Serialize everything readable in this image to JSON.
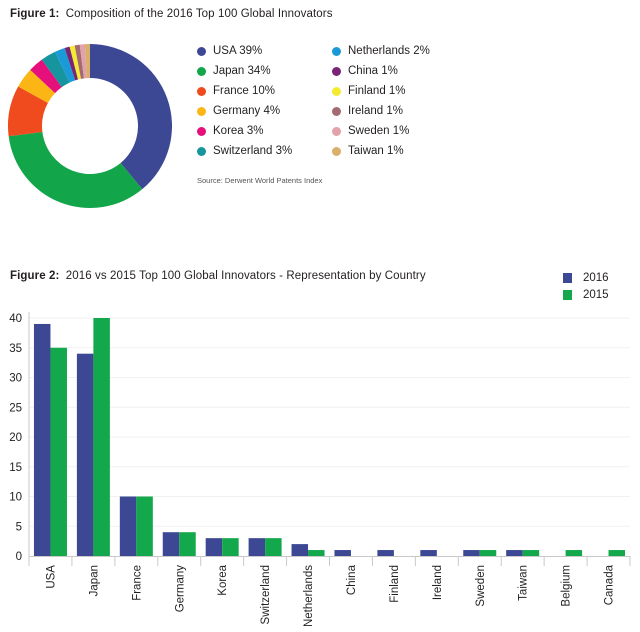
{
  "chart_data": [
    {
      "type": "pie",
      "donut": true,
      "title_prefix": "Figure 1:",
      "title": "Composition of the 2016 Top 100 Global Innovators",
      "categories": [
        "USA",
        "Japan",
        "France",
        "Germany",
        "Korea",
        "Switzerland",
        "Netherlands",
        "China",
        "Finland",
        "Ireland",
        "Sweden",
        "Taiwan"
      ],
      "values": [
        39,
        34,
        10,
        4,
        3,
        3,
        2,
        1,
        1,
        1,
        1,
        1
      ],
      "colors": [
        "#3d4895",
        "#12a54a",
        "#ef4b1f",
        "#fbb616",
        "#e5107c",
        "#17959f",
        "#1b9ad8",
        "#7a2476",
        "#f3eb30",
        "#a46a72",
        "#e3a1a9",
        "#d8b06a"
      ],
      "legend_labels": [
        "USA 39%",
        "Japan 34%",
        "France 10%",
        "Germany 4%",
        "Korea 3%",
        "Switzerland 3%",
        "Netherlands 2%",
        "China 1%",
        "Finland 1%",
        "Ireland 1%",
        "Sweden 1%",
        "Taiwan 1%"
      ],
      "legend": "right",
      "source": "Source: Derwent World Patents Index"
    },
    {
      "type": "bar",
      "title_prefix": "Figure 2:",
      "title": "2016 vs 2015 Top 100 Global Innovators - Representation by Country",
      "categories": [
        "USA",
        "Japan",
        "France",
        "Germany",
        "Korea",
        "Switzerland",
        "Netherlands",
        "China",
        "Finland",
        "Ireland",
        "Sweden",
        "Taiwan",
        "Belgium",
        "Canada"
      ],
      "series": [
        {
          "name": "2016",
          "color": "#3d4895",
          "values": [
            39,
            34,
            10,
            4,
            3,
            3,
            2,
            1,
            1,
            1,
            1,
            1,
            0,
            0
          ]
        },
        {
          "name": "2015",
          "color": "#13a84b",
          "values": [
            35,
            40,
            10,
            4,
            3,
            3,
            1,
            0,
            0,
            0,
            1,
            1,
            1,
            1
          ]
        }
      ],
      "xlabel": "",
      "ylabel": "",
      "ylim": [
        0,
        40
      ],
      "yticks": [
        "0",
        "5",
        "10",
        "15",
        "20",
        "25",
        "30",
        "35",
        "40"
      ],
      "grid": true,
      "legend": "top-right"
    }
  ]
}
